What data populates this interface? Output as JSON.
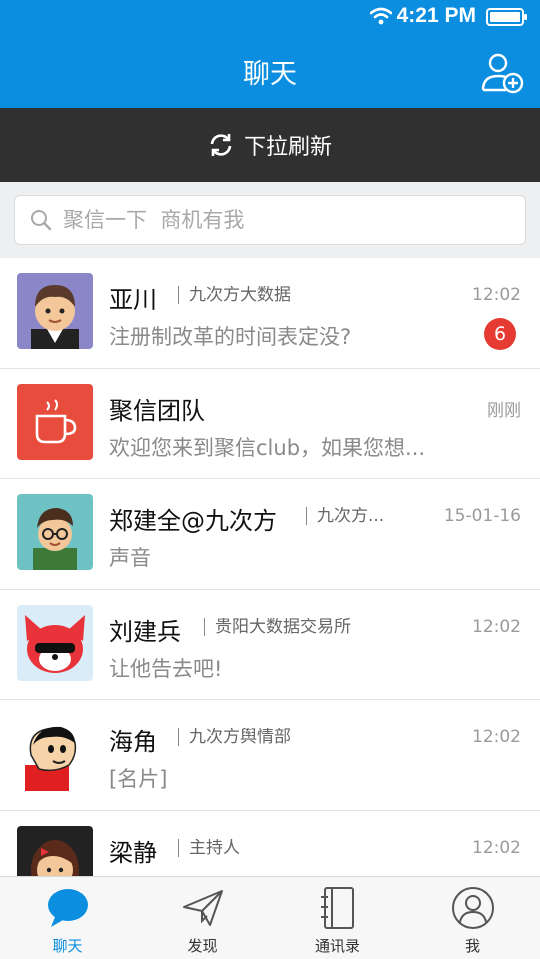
{
  "status": {
    "time": "4:21 PM"
  },
  "header": {
    "title": "聊天"
  },
  "refresh": {
    "label": "下拉刷新"
  },
  "search": {
    "placeholder": "聚信一下  商机有我"
  },
  "chats": [
    {
      "name": "亚川",
      "org": "九次方大数据",
      "time": "12:02",
      "preview": "注册制改革的时间表定没?",
      "badge": "6"
    },
    {
      "name": "聚信团队",
      "org": "",
      "time": "刚刚",
      "preview": "欢迎您来到聚信club，如果您想..."
    },
    {
      "name": "郑建全@九次方",
      "org": "九次方...",
      "time": "15-01-16",
      "preview": "声音"
    },
    {
      "name": "刘建兵",
      "org": "贵阳大数据交易所",
      "time": "12:02",
      "preview": "让他告去吧!"
    },
    {
      "name": "海角",
      "org": "九次方舆情部",
      "time": "12:02",
      "preview": "[名片]"
    },
    {
      "name": "梁静",
      "org": "主持人",
      "time": "12:02",
      "preview": ""
    }
  ],
  "tabs": [
    {
      "label": "聊天",
      "icon": "chat-bubble-icon",
      "active": true
    },
    {
      "label": "发现",
      "icon": "paper-plane-icon"
    },
    {
      "label": "通讯录",
      "icon": "address-book-icon"
    },
    {
      "label": "我",
      "icon": "user-icon"
    }
  ],
  "colors": {
    "brand": "#0b8ee0",
    "badge": "#e53b32",
    "refresh_bar": "#303030"
  }
}
